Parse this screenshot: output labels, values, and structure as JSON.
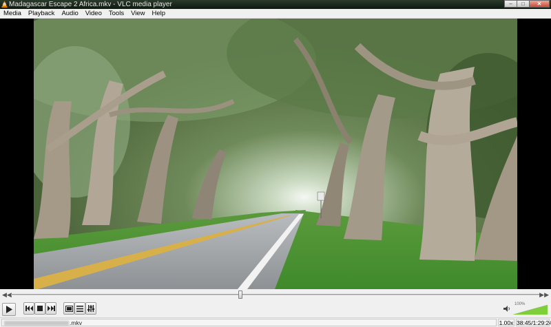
{
  "window": {
    "title": "Madagascar Escape 2 Africa.mkv - VLC media player",
    "controls": [
      "minimize",
      "maximize",
      "close"
    ],
    "minimize_glyph": "–",
    "maximize_glyph": "□",
    "close_glyph": "✕"
  },
  "menu": {
    "items": [
      "Media",
      "Playback",
      "Audio",
      "Video",
      "Tools",
      "View",
      "Help"
    ]
  },
  "video": {
    "description_icon": "video-frame"
  },
  "seek": {
    "position_fraction": 0.433,
    "back_glyph": "◀◀",
    "fwd_glyph": "▶▶"
  },
  "controls": {
    "buttons": [
      "play",
      "previous",
      "stop",
      "next",
      "fullscreen",
      "playlist",
      "extended-settings"
    ]
  },
  "volume": {
    "level_percent": 100,
    "label": "100%"
  },
  "status": {
    "filename": ".mkv",
    "speed": "1.00x",
    "time": "38:45/1:29:24"
  },
  "colors": {
    "chrome": "#f0f0f0",
    "volume_fill": "#7fcf3a"
  }
}
